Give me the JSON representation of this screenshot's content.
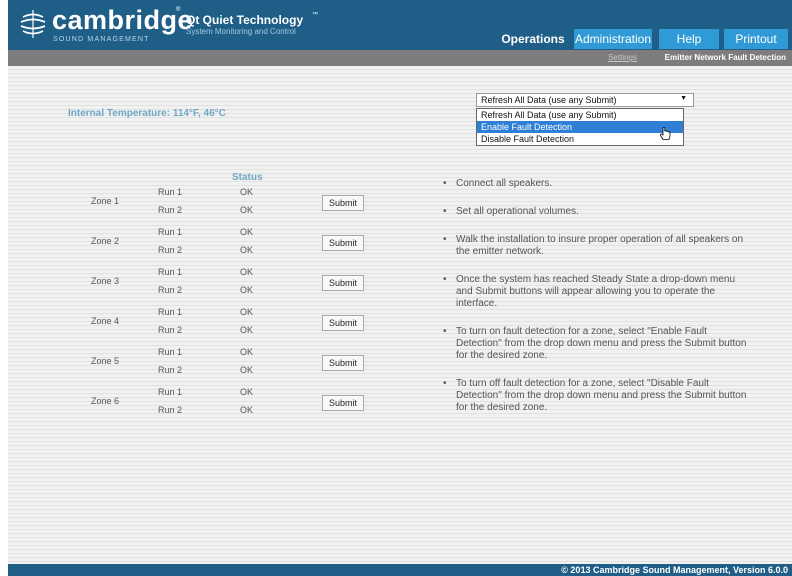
{
  "brand": {
    "name": "cambridge",
    "trademark": "®",
    "subtitle": "SOUND MANAGEMENT",
    "product": "Qt Quiet Technology",
    "product_trademark": "™",
    "product_subtitle": "System Monitoring and Control"
  },
  "nav": {
    "tabs": [
      {
        "label": "Operations",
        "active": true
      },
      {
        "label": "Administration",
        "active": false
      },
      {
        "label": "Help",
        "active": false
      },
      {
        "label": "Printout",
        "active": false
      }
    ]
  },
  "subnav": {
    "settings": "Settings",
    "current": "Emitter Network Fault Detection"
  },
  "temperature": "Internal Temperature: 114°F, 46°C",
  "action_select": {
    "selected": "Refresh All Data (use any Submit)",
    "options": [
      {
        "label": "Refresh All Data (use any Submit)",
        "highlighted": false
      },
      {
        "label": "Enable Fault Detection",
        "highlighted": true
      },
      {
        "label": "Disable Fault Detection",
        "highlighted": false
      }
    ]
  },
  "status_header": "Status",
  "zones": [
    {
      "name": "Zone 1",
      "runs": [
        {
          "label": "Run 1",
          "status": "OK"
        },
        {
          "label": "Run 2",
          "status": "OK"
        }
      ],
      "submit": "Submit"
    },
    {
      "name": "Zone 2",
      "runs": [
        {
          "label": "Run 1",
          "status": "OK"
        },
        {
          "label": "Run 2",
          "status": "OK"
        }
      ],
      "submit": "Submit"
    },
    {
      "name": "Zone 3",
      "runs": [
        {
          "label": "Run 1",
          "status": "OK"
        },
        {
          "label": "Run 2",
          "status": "OK"
        }
      ],
      "submit": "Submit"
    },
    {
      "name": "Zone 4",
      "runs": [
        {
          "label": "Run 1",
          "status": "OK"
        },
        {
          "label": "Run 2",
          "status": "OK"
        }
      ],
      "submit": "Submit"
    },
    {
      "name": "Zone 5",
      "runs": [
        {
          "label": "Run 1",
          "status": "OK"
        },
        {
          "label": "Run 2",
          "status": "OK"
        }
      ],
      "submit": "Submit"
    },
    {
      "name": "Zone 6",
      "runs": [
        {
          "label": "Run 1",
          "status": "OK"
        },
        {
          "label": "Run 2",
          "status": "OK"
        }
      ],
      "submit": "Submit"
    }
  ],
  "instructions": [
    "Connect all speakers.",
    "Set all operational volumes.",
    "Walk the installation to insure proper operation of all speakers on the emitter network.",
    "Once the system has reached Steady State a drop-down menu and Submit buttons will appear allowing you to operate the interface.",
    "To turn on fault detection for a zone, select \"Enable Fault Detection\" from the drop down menu and press the Submit button for the desired zone.",
    "To turn off fault detection for a zone, select \"Disable Fault Detection\" from the drop down menu and press the Submit button for the desired zone."
  ],
  "footer": "© 2013 Cambridge Sound Management, Version 6.0.0",
  "colors": {
    "header": "#1f5f87",
    "tab": "#2f9ad6",
    "accent_text": "#6fa8c6",
    "highlight": "#2f7fd6"
  }
}
